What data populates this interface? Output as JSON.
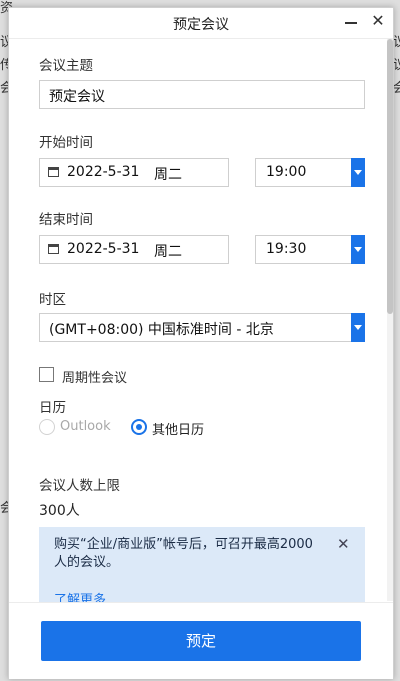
{
  "background": {
    "fragments": [
      "资",
      "议",
      "会",
      "会",
      "传",
      "会",
      "」",
      "议",
      "议"
    ]
  },
  "window": {
    "title": "预定会议",
    "minimize_label": "",
    "close_label": "✕"
  },
  "topic": {
    "label": "会议主题",
    "value": "预定会议"
  },
  "start": {
    "label": "开始时间",
    "date": "2022-5-31",
    "weekday": "周二",
    "time": "19:00"
  },
  "end": {
    "label": "结束时间",
    "date": "2022-5-31",
    "weekday": "周二",
    "time": "19:30"
  },
  "timezone": {
    "label": "时区",
    "value": "(GMT+08:00) 中国标准时间 - 北京"
  },
  "recurring": {
    "label": "周期性会议",
    "checked": false
  },
  "calendar": {
    "label": "日历",
    "options": [
      {
        "label": "Outlook",
        "selected": false,
        "disabled": true
      },
      {
        "label": "其他日历",
        "selected": true,
        "disabled": false
      }
    ]
  },
  "capacity": {
    "label": "会议人数上限",
    "value": "300人"
  },
  "notice": {
    "text": "购买“企业/商业版”帐号后，可召开最高2000人的会议。",
    "link": "了解更多",
    "close": "✕"
  },
  "footer": {
    "submit_label": "预定"
  },
  "colors": {
    "accent": "#1a73e8",
    "notice_bg": "#dce9f8"
  }
}
